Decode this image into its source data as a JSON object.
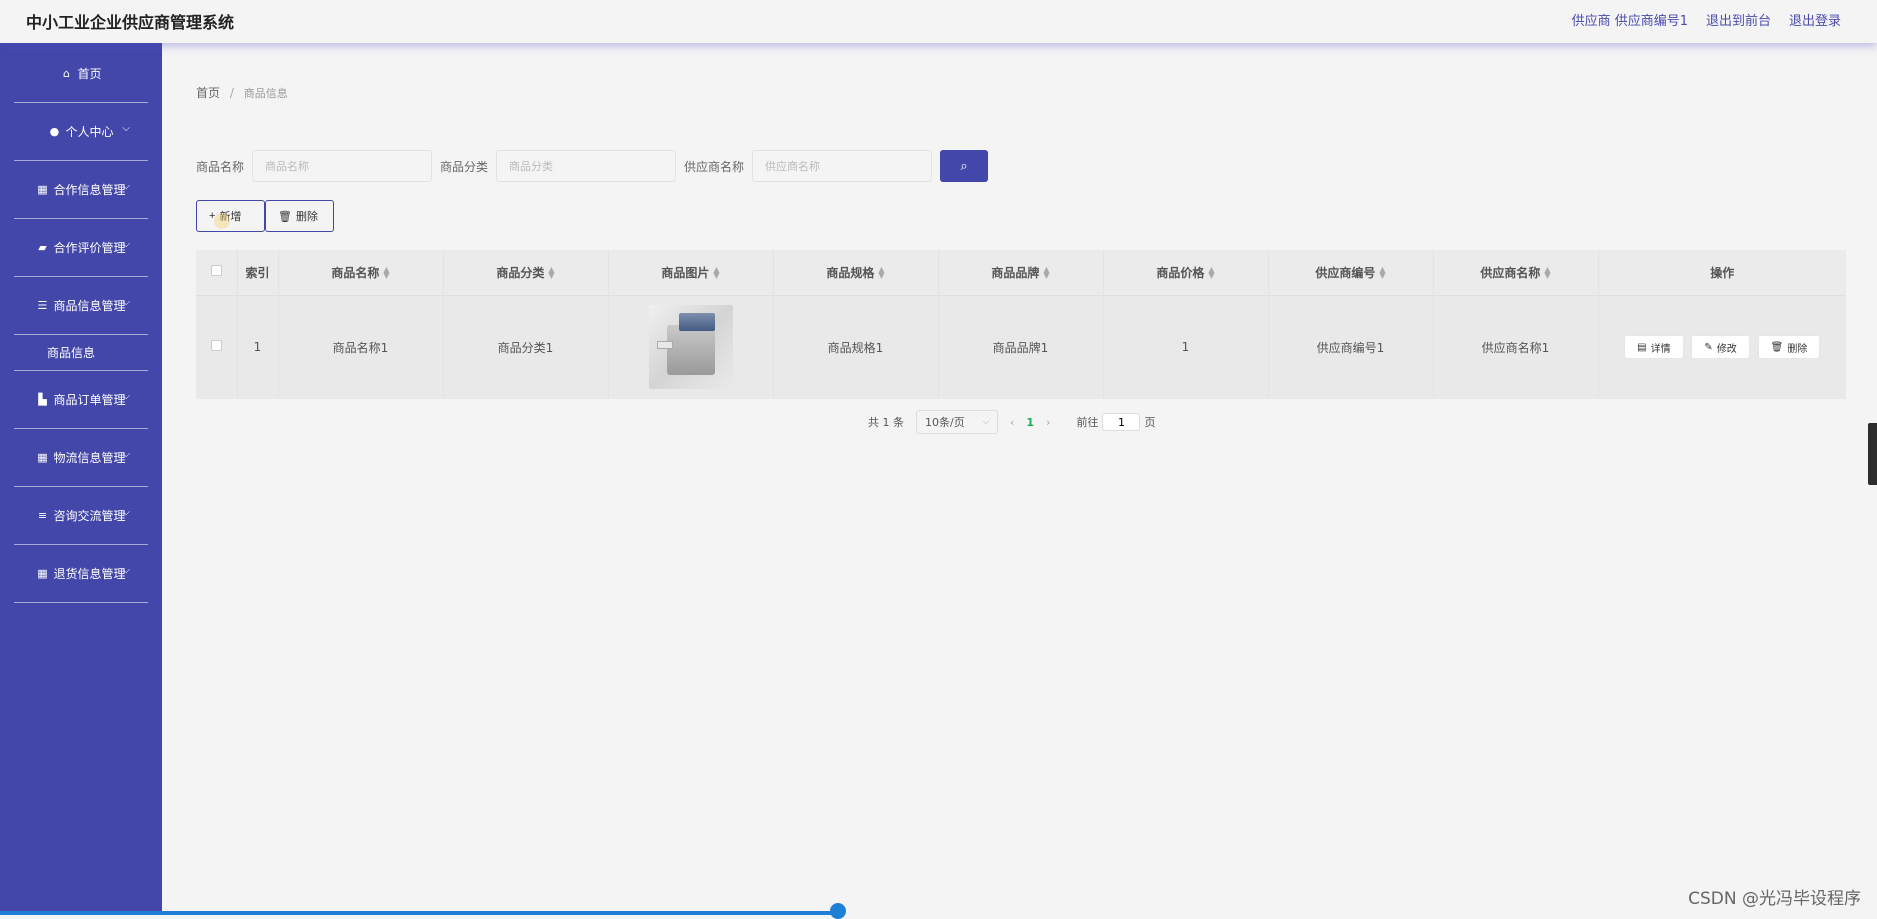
{
  "header": {
    "title": "中小工业企业供应商管理系统",
    "user": "供应商 供应商编号1",
    "front_link": "退出到前台",
    "logout": "退出登录"
  },
  "sidebar": {
    "items": [
      {
        "label": "首页",
        "icon": "home-icon",
        "glyph": "⌂",
        "has_children": false
      },
      {
        "label": "个人中心",
        "icon": "user-icon",
        "glyph": "●",
        "has_children": true
      },
      {
        "label": "合作信息管理",
        "icon": "grid-icon",
        "glyph": "▦",
        "has_children": true
      },
      {
        "label": "合作评价管理",
        "icon": "briefcase-icon",
        "glyph": "▰",
        "has_children": true
      },
      {
        "label": "商品信息管理",
        "icon": "sliders-icon",
        "glyph": "☰",
        "has_children": true
      },
      {
        "label": "商品订单管理",
        "icon": "truck-icon",
        "glyph": "▙",
        "has_children": true
      },
      {
        "label": "物流信息管理",
        "icon": "grid-icon",
        "glyph": "▦",
        "has_children": true
      },
      {
        "label": "咨询交流管理",
        "icon": "list-icon",
        "glyph": "≡",
        "has_children": true
      },
      {
        "label": "退货信息管理",
        "icon": "grid-icon",
        "glyph": "▦",
        "has_children": true
      }
    ],
    "submenu": {
      "label": "商品信息"
    }
  },
  "breadcrumb": {
    "home": "首页",
    "separator": "/",
    "current": "商品信息"
  },
  "search": {
    "name_label": "商品名称",
    "name_placeholder": "商品名称",
    "category_label": "商品分类",
    "category_placeholder": "商品分类",
    "supplier_label": "供应商名称",
    "supplier_placeholder": "供应商名称"
  },
  "actions": {
    "add": "新增",
    "delete": "删除"
  },
  "table": {
    "columns": [
      "索引",
      "商品名称",
      "商品分类",
      "商品图片",
      "商品规格",
      "商品品牌",
      "商品价格",
      "供应商编号",
      "供应商名称",
      "操作"
    ],
    "rows": [
      {
        "index": "1",
        "name": "商品名称1",
        "category": "商品分类1",
        "spec": "商品规格1",
        "brand": "商品品牌1",
        "price": "1",
        "supplier_id": "供应商编号1",
        "supplier_name": "供应商名称1"
      }
    ],
    "ops": {
      "detail": "详情",
      "edit": "修改",
      "delete": "删除"
    }
  },
  "pagination": {
    "total": "共 1 条",
    "page_size": "10条/页",
    "current_page": "1",
    "goto_label": "前往",
    "goto_value": "1",
    "page_suffix": "页"
  },
  "watermark": "CSDN @光冯毕设程序",
  "colors": {
    "brand": "#4347a9",
    "active_page": "#1bab57",
    "background": "#f4f4f4"
  }
}
